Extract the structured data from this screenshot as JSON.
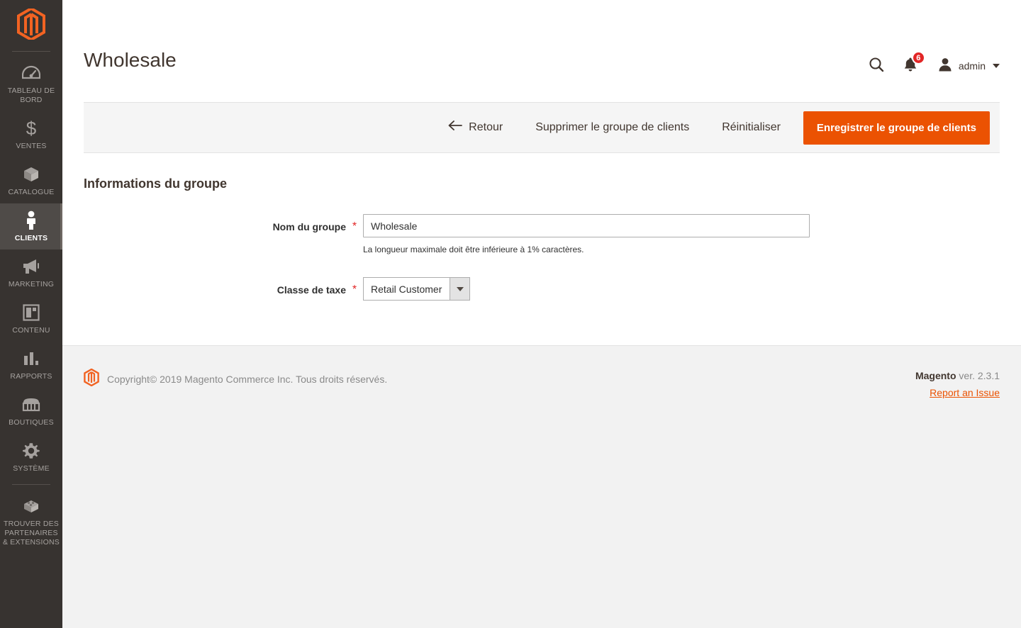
{
  "sidebar": {
    "logo_icon": "magento-logo-icon",
    "items": [
      {
        "label": "Tableau de bord",
        "icon": "dashboard-gauge-icon",
        "key": "dashboard",
        "active": false
      },
      {
        "label": "Ventes",
        "icon": "dollar-sign-icon",
        "key": "sales",
        "active": false
      },
      {
        "label": "Catalogue",
        "icon": "box-icon",
        "key": "catalog",
        "active": false
      },
      {
        "label": "Clients",
        "icon": "person-icon",
        "key": "customers",
        "active": true
      },
      {
        "label": "Marketing",
        "icon": "megaphone-icon",
        "key": "marketing",
        "active": false
      },
      {
        "label": "Contenu",
        "icon": "layout-panels-icon",
        "key": "content",
        "active": false
      },
      {
        "label": "Rapports",
        "icon": "bar-chart-icon",
        "key": "reports",
        "active": false
      },
      {
        "label": "Boutiques",
        "icon": "storefront-icon",
        "key": "stores",
        "active": false
      },
      {
        "label": "Système",
        "icon": "gear-icon",
        "key": "system",
        "active": false
      },
      {
        "label": "Trouver des partenaires & extensions",
        "icon": "extension-brick-icon",
        "key": "partners",
        "active": false
      }
    ]
  },
  "header": {
    "title": "Wholesale",
    "search_icon": "search-icon",
    "notifications_icon": "bell-icon",
    "notifications_count": "6",
    "account_icon": "user-avatar-icon",
    "account_name": "admin",
    "caret_icon": "chevron-down-icon"
  },
  "toolbar": {
    "back_icon": "arrow-left-icon",
    "back_label": "Retour",
    "delete_label": "Supprimer le groupe de clients",
    "reset_label": "Réinitialiser",
    "save_label": "Enregistrer le groupe de clients"
  },
  "form": {
    "section_title": "Informations du groupe",
    "required_marker": "*",
    "group_name": {
      "label": "Nom du groupe",
      "value": "Wholesale",
      "placeholder": "",
      "note": "La longueur maximale doit être inférieure à 1% caractères."
    },
    "tax_class": {
      "label": "Classe de taxe",
      "value": "Retail Customer",
      "arrow_icon": "chevron-down-icon"
    }
  },
  "footer": {
    "logo_icon": "magento-logo-icon",
    "copyright": "Copyright© 2019 Magento Commerce Inc. Tous droits réservés.",
    "brand": "Magento",
    "version": " ver. 2.3.1",
    "report_link": "Report an Issue"
  },
  "colors": {
    "accent_orange": "#eb5202",
    "sidebar_bg": "#373330",
    "sidebar_active_bg": "#4f4b48",
    "badge_red": "#e22626",
    "required_red": "#e22626",
    "toolbar_bg": "#f5f5f5",
    "footer_bg": "#f2f2f2"
  }
}
